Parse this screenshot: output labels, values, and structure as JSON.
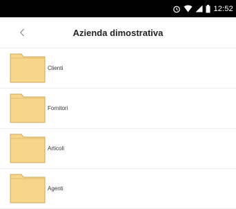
{
  "status_bar": {
    "time": "12:52",
    "icons": [
      "alarm-icon",
      "wifi-icon",
      "signal-icon",
      "battery-icon"
    ]
  },
  "header": {
    "back_icon": "chevron-left-icon",
    "title": "Azienda dimostrativa"
  },
  "folders": [
    {
      "label": "Clienti",
      "icon": "folder-icon"
    },
    {
      "label": "Fornitori",
      "icon": "folder-icon"
    },
    {
      "label": "Articoli",
      "icon": "folder-icon"
    },
    {
      "label": "Agenti",
      "icon": "folder-icon"
    }
  ],
  "colors": {
    "folder_fill": "#F7D58A",
    "folder_stroke": "#C9A85F",
    "status_bar": "#000000"
  }
}
